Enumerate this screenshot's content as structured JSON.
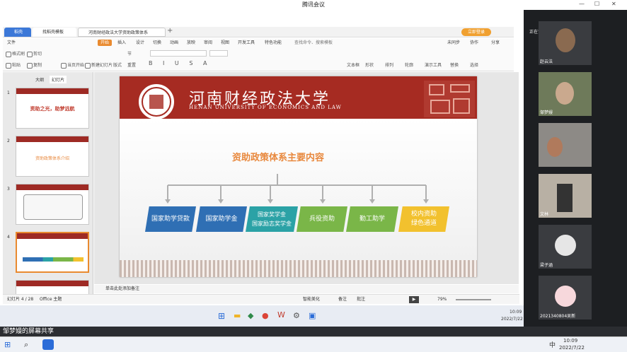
{
  "meeting": {
    "title": "腾讯会议"
  },
  "browser": {
    "tabs": [
      {
        "label": "稻壳",
        "active": false
      },
      {
        "label": "找稻壳模板",
        "active": false
      },
      {
        "label": "河南财经政法大学资助政策体系",
        "active": true
      }
    ],
    "badge": "立即登录"
  },
  "ppt": {
    "menus": [
      "文件",
      "开始",
      "插入",
      "设计",
      "切换",
      "动画",
      "放映",
      "审阅",
      "视图",
      "开发工具",
      "特色功能"
    ],
    "active_menu": "开始",
    "search_placeholder": "查找命令、搜索模板",
    "right_menus": [
      "未同步",
      "协作",
      "分享"
    ],
    "toolbar": [
      "格式刷",
      "粘贴",
      "剪切",
      "复制",
      "当页开始",
      "新建幻灯片",
      "版式",
      "节",
      "重置",
      "文本框",
      "形状",
      "排列",
      "轮廓",
      "演示工具",
      "替换",
      "选择"
    ],
    "panel_tabs": [
      "大纲",
      "幻灯片"
    ],
    "thumbs": [
      {
        "num": "1",
        "text": "资助之光，助梦远航"
      },
      {
        "num": "2",
        "text": "资助政策体系介绍"
      },
      {
        "num": "3",
        "text": ""
      },
      {
        "num": "4",
        "text": ""
      }
    ],
    "slide": {
      "uni_cn": "河南财经政法大学",
      "uni_en": "HENAN UNIVERSITY OF ECONOMICS AND LAW",
      "title": "资助政策体系主要内容",
      "boxes": [
        {
          "line1": "国家助学贷款",
          "line2": "",
          "color": "#2f6fb4"
        },
        {
          "line1": "国家助学金",
          "line2": "",
          "color": "#2f6fb4"
        },
        {
          "line1": "国家奖学金",
          "line2": "国家励志奖学金",
          "color": "#2ba2a6"
        },
        {
          "line1": "兵役资助",
          "line2": "",
          "color": "#7ab648"
        },
        {
          "line1": "勤工助学",
          "line2": "",
          "color": "#7ab648"
        },
        {
          "line1": "校内资助",
          "line2": "绿色通道",
          "color": "#f2c12e"
        }
      ]
    },
    "notes": "单击此处添加备注",
    "status_left": "幻灯片 4 / 28",
    "status_theme": "Office 主题",
    "status_beautify": "智能美化",
    "status_notes": "备注",
    "status_comment": "批注",
    "zoom": "79%",
    "clock_time": "10:09",
    "clock_date": "2022/7/22"
  },
  "panel": {
    "speaking": "正在讲话：邹梦嫚",
    "participants": [
      "赵云法",
      "邹梦嫚",
      "",
      "文林",
      "梁子涵",
      "2021340804吴新"
    ]
  },
  "bottom": {
    "share_text": "邹梦嫚的屏幕共享",
    "time": "10:09",
    "date": "2022/7/22",
    "ime": "中"
  }
}
